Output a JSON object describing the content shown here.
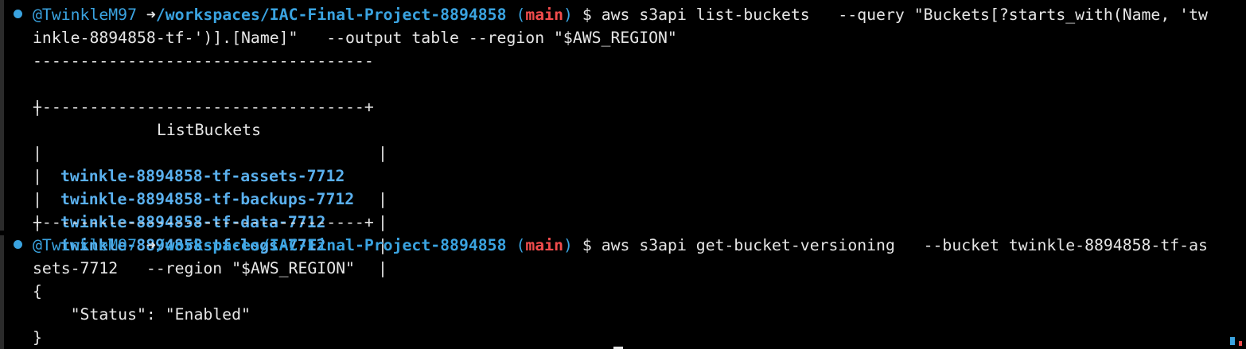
{
  "terminal": {
    "prompt1": {
      "user": "@TwinkleM97",
      "arrow": "➜",
      "path": "/workspaces/IAC-Final-Project-8894858",
      "branch_open": "(",
      "branch": "main",
      "branch_close": ")",
      "symbol": "$",
      "command_line1": "aws s3api list-buckets   --query \"Buckets[?starts_with(Name, 'tw",
      "command_line2": "inkle-8894858-tf-')].[Name]\"   --output table --region \"$AWS_REGION\""
    },
    "table": {
      "border_top": "------------------------------------",
      "header_row_left": "|",
      "header": "ListBuckets",
      "header_row_right": "|",
      "border_mid": "+----------------------------------+",
      "pipe": "|",
      "rows": [
        "twinkle-8894858-tf-assets-7712",
        "twinkle-8894858-tf-backups-7712",
        "twinkle-8894858-tf-data-7712",
        "twinkle-8894858-tf-logs-7712"
      ],
      "border_bottom": "+----------------------------------+"
    },
    "prompt2": {
      "user": "@TwinkleM97",
      "arrow": "➜",
      "path": "/workspaces/IAC-Final-Project-8894858",
      "branch_open": "(",
      "branch": "main",
      "branch_close": ")",
      "symbol": "$",
      "command_line1": "aws s3api get-bucket-versioning   --bucket twinkle-8894858-tf-as",
      "command_line2": "sets-7712   --region \"$AWS_REGION\""
    },
    "json_output": {
      "open_brace": "{",
      "status_line": "    \"Status\": \"Enabled\"",
      "close_brace": "}"
    },
    "colors": {
      "background": "#000000",
      "user": "#3aa3e0",
      "branch": "#f14c4c",
      "bucket": "#5ab0ee",
      "text": "#e6e6e6"
    },
    "icons": {
      "prompt_marker": "circle-dot-icon"
    }
  }
}
